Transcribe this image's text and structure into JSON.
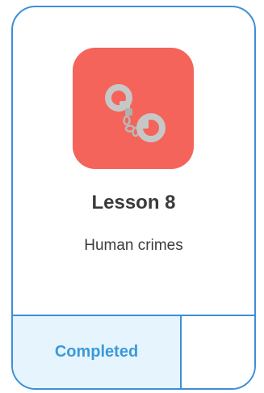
{
  "lesson": {
    "title": "Lesson 8",
    "subtitle": "Human crimes",
    "status": "Completed",
    "icon": "handcuffs-icon"
  },
  "colors": {
    "border": "#3d8fd6",
    "icon_background": "#f4645a",
    "status_background": "#e6f4fd",
    "status_text": "#3a9ad9",
    "text": "#3a3a3a"
  }
}
